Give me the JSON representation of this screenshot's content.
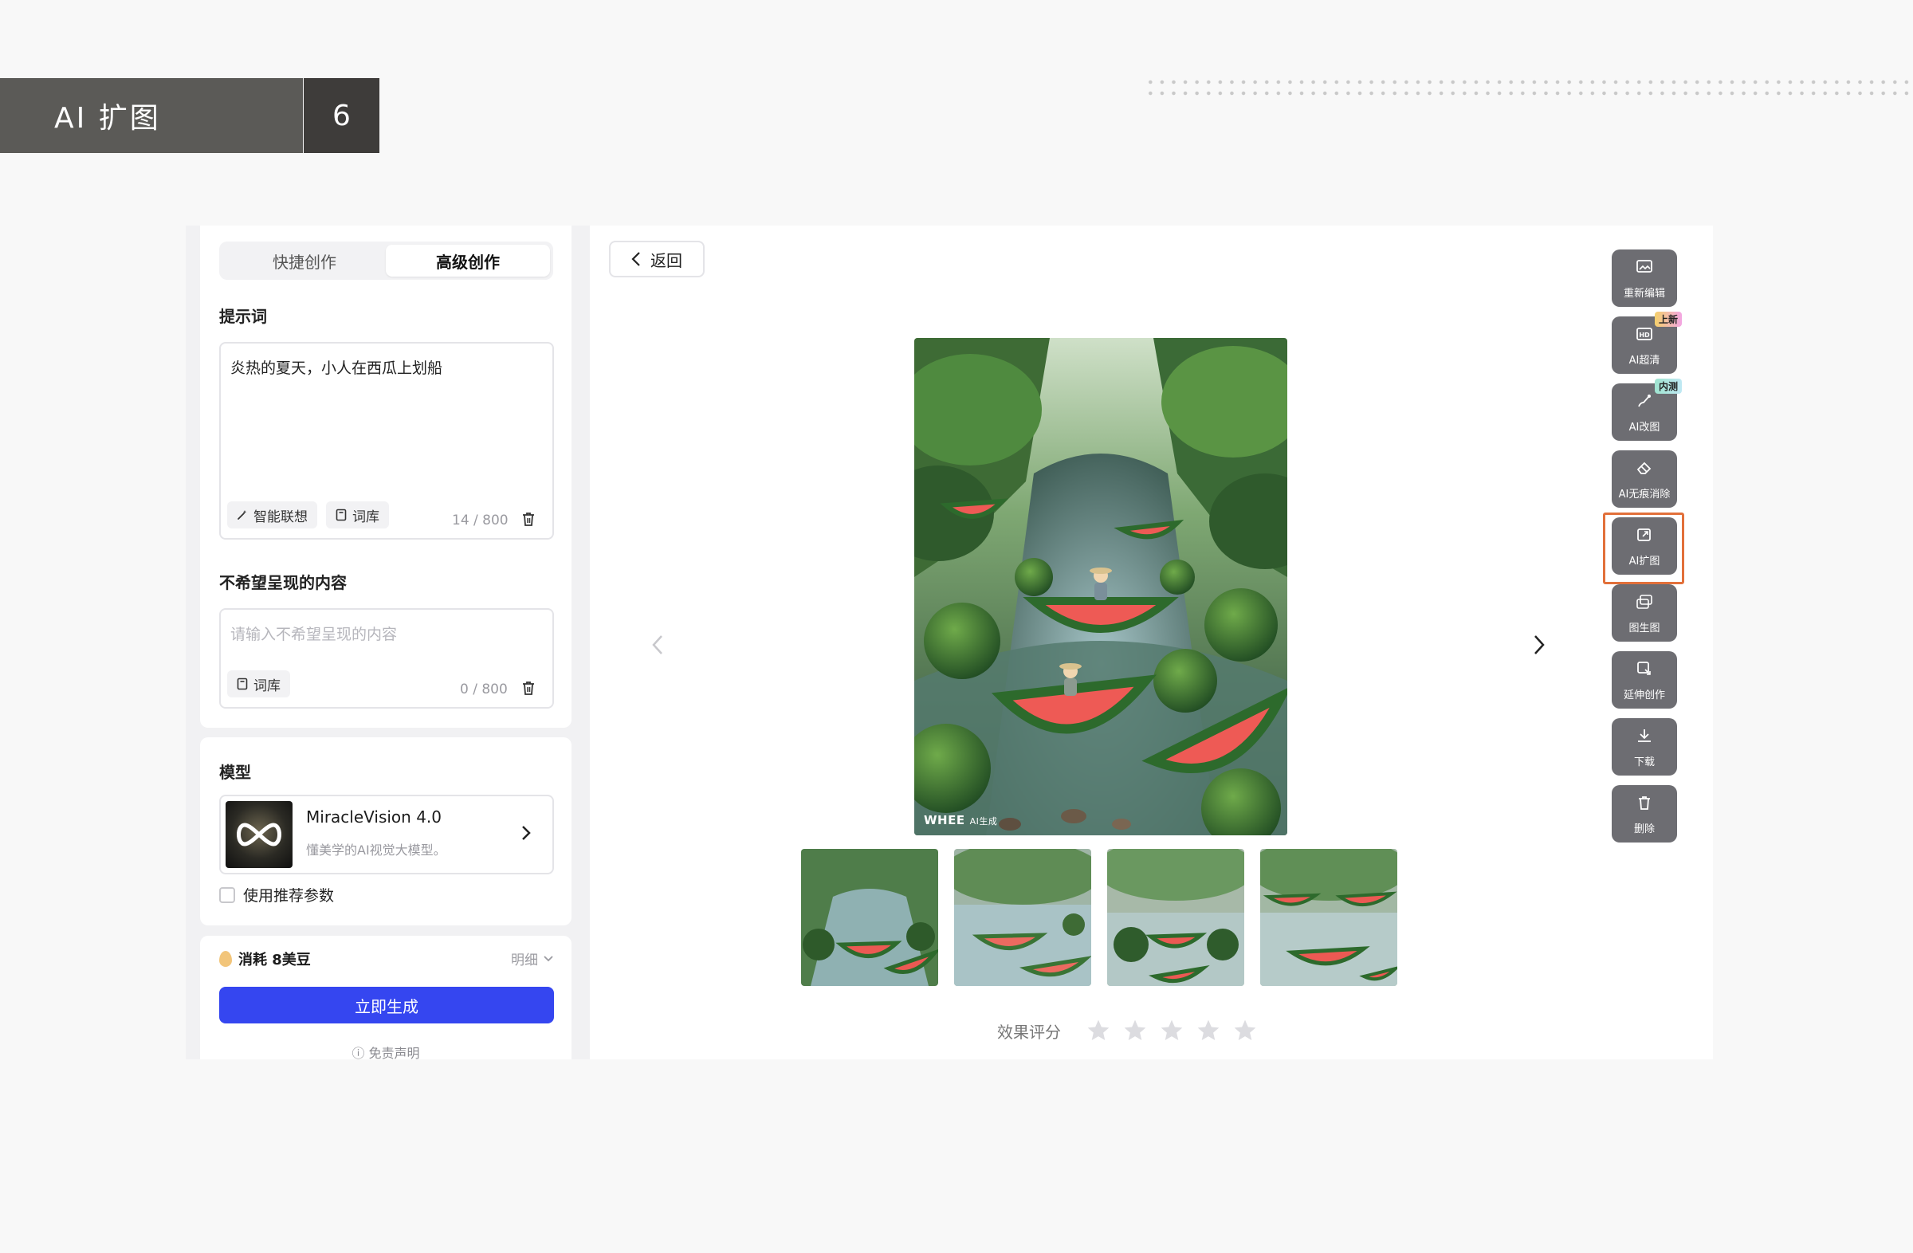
{
  "slide": {
    "title": "AI 扩图",
    "number": "6"
  },
  "creation_tabs": [
    {
      "label": "快捷创作",
      "active": false
    },
    {
      "label": "高级创作",
      "active": true
    }
  ],
  "prompt": {
    "label": "提示词",
    "value": "炎热的夏天，小人在西瓜上划船",
    "smart_assoc": "智能联想",
    "lexicon": "词库",
    "counter": "14 / 800"
  },
  "negative": {
    "label": "不希望呈现的内容",
    "placeholder": "请输入不希望呈现的内容",
    "lexicon": "词库",
    "counter": "0 / 800"
  },
  "model": {
    "label": "模型",
    "name": "MiracleVision 4.0",
    "desc": "懂美学的AI视觉大模型。",
    "use_recommended": "使用推荐参数"
  },
  "generate": {
    "cost": "消耗 8美豆",
    "detail": "明细",
    "button": "立即生成",
    "disclaimer": "免责声明"
  },
  "main": {
    "back": "返回",
    "watermark_brand": "WHEE",
    "watermark_tag": "AI生成",
    "rating_label": "效果评分",
    "rating_stars": 0,
    "thumbnails": 4,
    "selected_thumbnail": 1
  },
  "toolbar": [
    {
      "id": "reedit",
      "label": "重新编辑",
      "icon": "image-edit-icon"
    },
    {
      "id": "upscale",
      "label": "AI超清",
      "icon": "hd-icon",
      "badge": "上新"
    },
    {
      "id": "modify",
      "label": "AI改图",
      "icon": "brush-icon",
      "badge": "内测"
    },
    {
      "id": "erase",
      "label": "AI无痕消除",
      "icon": "eraser-icon"
    },
    {
      "id": "expand",
      "label": "AI扩图",
      "icon": "expand-icon",
      "highlighted": true
    },
    {
      "id": "img2img",
      "label": "图生图",
      "icon": "image-to-image-icon"
    },
    {
      "id": "extend",
      "label": "延伸创作",
      "icon": "extend-icon"
    },
    {
      "id": "download",
      "label": "下载",
      "icon": "download-icon"
    },
    {
      "id": "delete",
      "label": "删除",
      "icon": "trash-icon"
    }
  ],
  "colors": {
    "accent": "#3546f0",
    "toolbar_bg": "#6d6d72",
    "highlight": "#e2703a",
    "banner": "#5b5a57"
  }
}
